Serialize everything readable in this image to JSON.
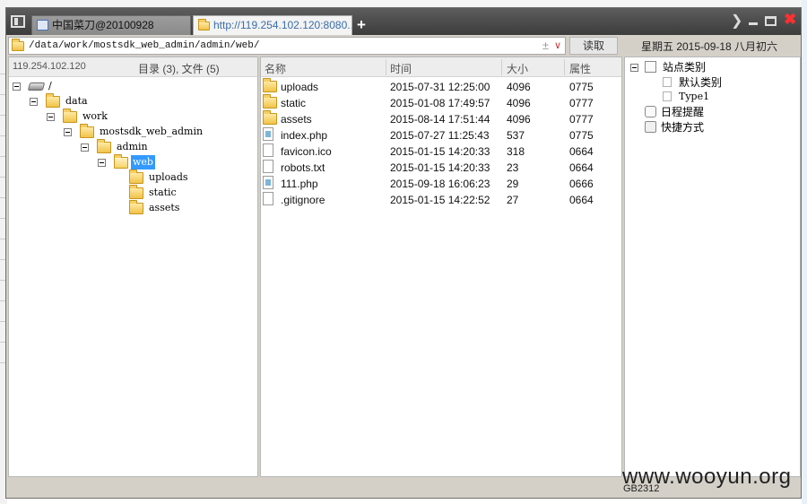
{
  "titlebar": {
    "tabs": [
      {
        "label": "中国菜刀@20100928",
        "active": false
      },
      {
        "label": "http://119.254.102.120:8080...",
        "active": true
      }
    ],
    "add_tab_label": "+"
  },
  "addressbar": {
    "path": "/data/work/mostsdk_web_admin/admin/web/",
    "dropdown_glyph": "±",
    "chevron_glyph": "⌄",
    "read_button": "读取",
    "date": "星期五 2015-09-18 八月初六"
  },
  "left_panel": {
    "ip": "119.254.102.120",
    "summary": "目录 (3), 文件 (5)",
    "tree": [
      {
        "label": "/",
        "icon": "drive-icon"
      },
      {
        "label": "data",
        "icon": "folder-icon"
      },
      {
        "label": "work",
        "icon": "folder-icon"
      },
      {
        "label": "mostsdk_web_admin",
        "icon": "folder-icon"
      },
      {
        "label": "admin",
        "icon": "folder-icon"
      },
      {
        "label": "web",
        "icon": "folder-open-icon",
        "selected": true
      },
      {
        "label": "uploads",
        "icon": "folder-icon"
      },
      {
        "label": "static",
        "icon": "folder-icon"
      },
      {
        "label": "assets",
        "icon": "folder-icon"
      }
    ]
  },
  "file_list": {
    "columns": [
      "名称",
      "时间",
      "大小",
      "属性"
    ],
    "rows": [
      {
        "name": "uploads",
        "time": "2015-07-31 12:25:00",
        "size": "4096",
        "attr": "0775",
        "icon": "folder-icon"
      },
      {
        "name": "static",
        "time": "2015-01-08 17:49:57",
        "size": "4096",
        "attr": "0777",
        "icon": "folder-icon"
      },
      {
        "name": "assets",
        "time": "2015-08-14 17:51:44",
        "size": "4096",
        "attr": "0777",
        "icon": "folder-icon"
      },
      {
        "name": "index.php",
        "time": "2015-07-27 11:25:43",
        "size": "537",
        "attr": "0775",
        "icon": "php-file-icon"
      },
      {
        "name": "favicon.ico",
        "time": "2015-01-15 14:20:33",
        "size": "318",
        "attr": "0664",
        "icon": "file-icon"
      },
      {
        "name": "robots.txt",
        "time": "2015-01-15 14:20:33",
        "size": "23",
        "attr": "0664",
        "icon": "file-icon"
      },
      {
        "name": "111.php",
        "time": "2015-09-18 16:06:23",
        "size": "29",
        "attr": "0666",
        "icon": "php-file-icon"
      },
      {
        "name": ".gitignore",
        "time": "2015-01-15 14:22:52",
        "size": "27",
        "attr": "0664",
        "icon": "file-icon"
      }
    ]
  },
  "right_panel": {
    "items": [
      {
        "label": "站点类别",
        "icon": "checkbox-icon"
      },
      {
        "label": "默认类别",
        "icon": "page-icon"
      },
      {
        "label": "Type1",
        "icon": "page-icon"
      },
      {
        "label": "日程提醒",
        "icon": "schedule-icon"
      },
      {
        "label": "快捷方式",
        "icon": "shortcut-icon"
      }
    ]
  },
  "statusbar": {
    "encoding": "GB2312"
  },
  "watermark": "www.wooyun.org",
  "colors": {
    "titlebar": "#4a4a4a",
    "selection": "#3399ff",
    "close": "#ff3030",
    "active_tab_text": "#3a6ea8"
  }
}
